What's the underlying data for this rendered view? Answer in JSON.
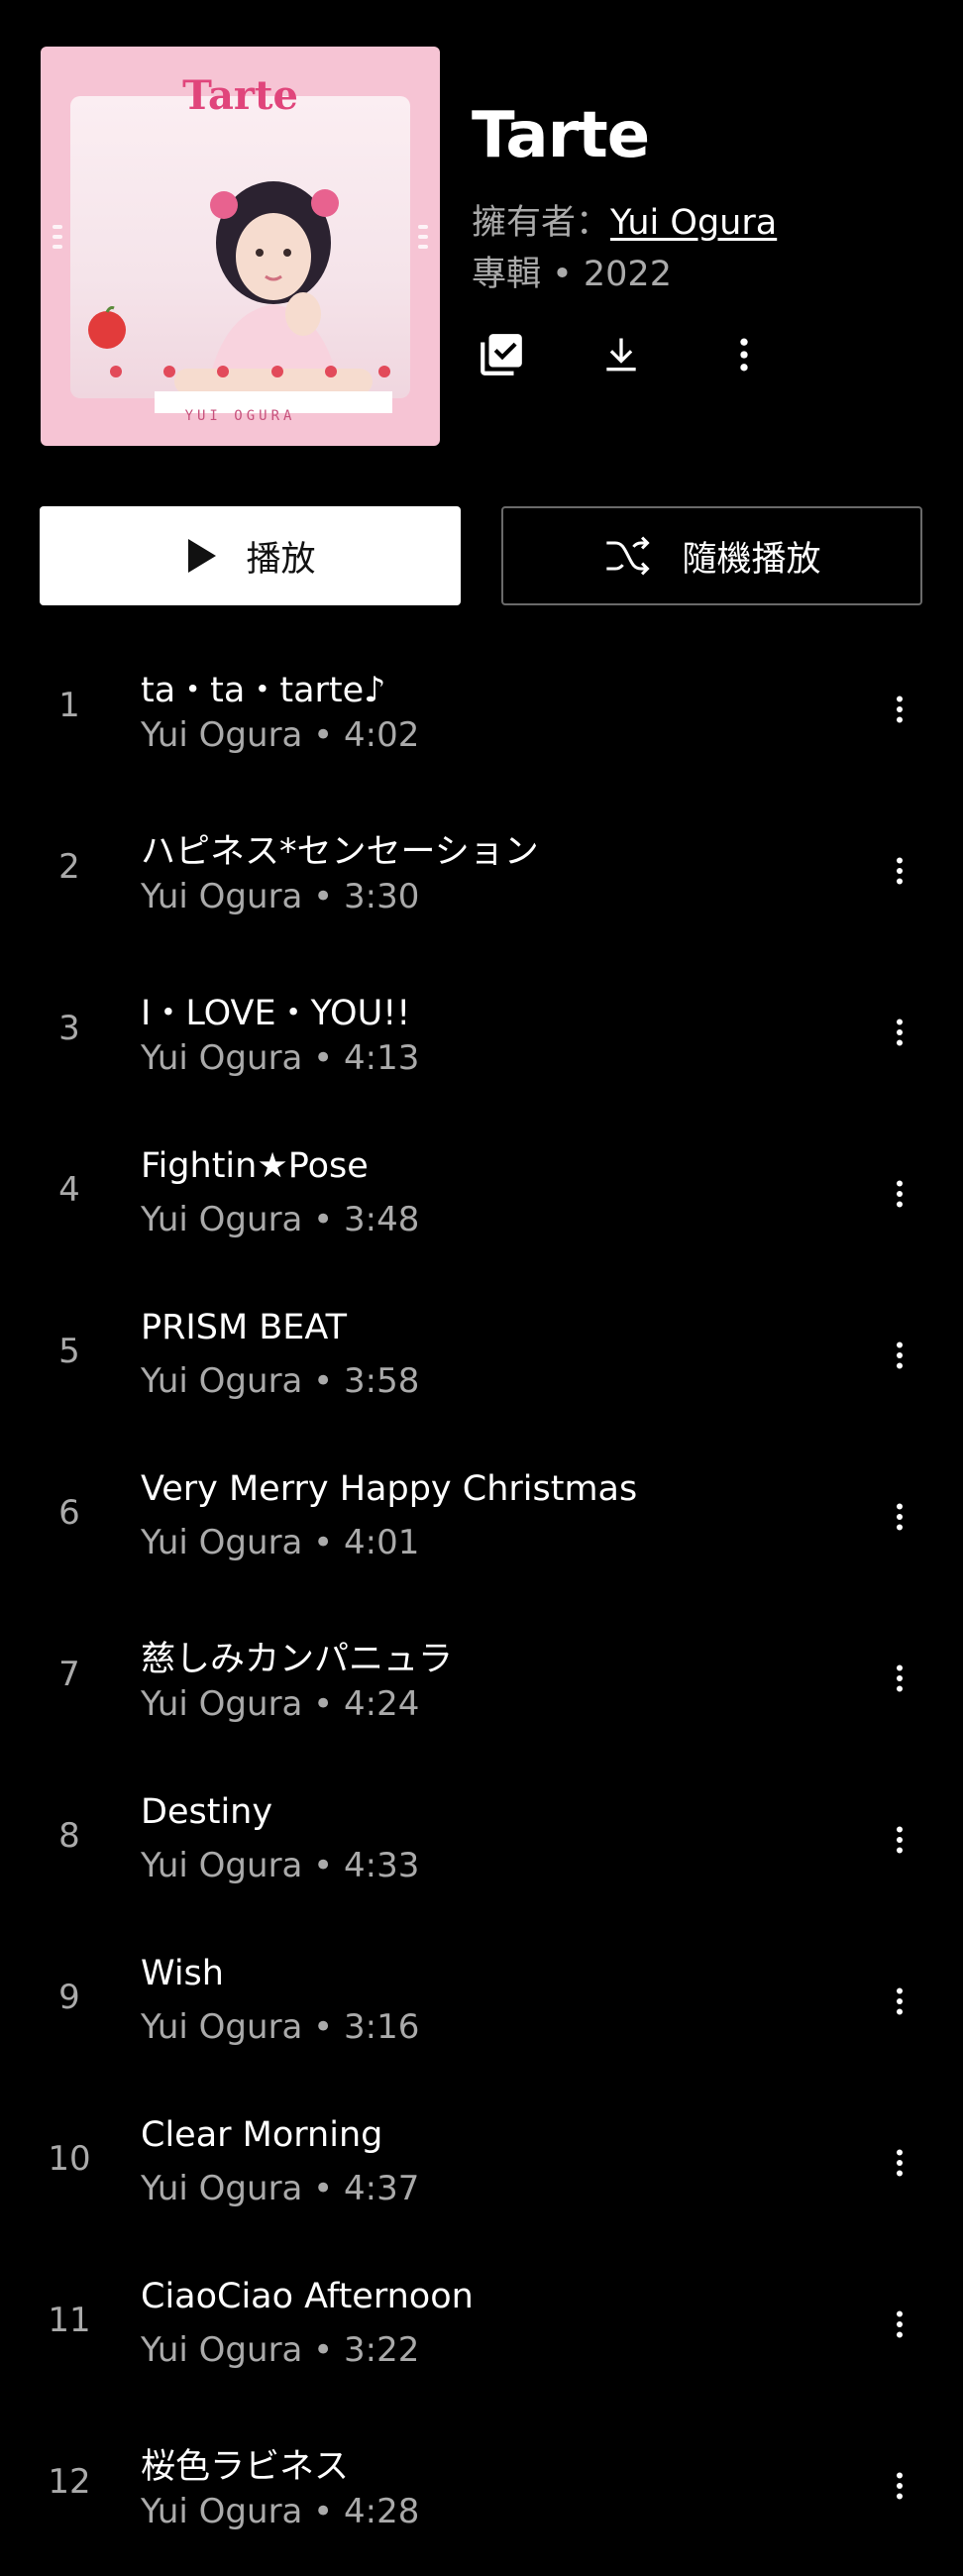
{
  "album": {
    "title": "Tarte",
    "owner_prefix": "擁有者：",
    "owner_name": "Yui Ogura",
    "meta": "專輯 • 2022",
    "cover": {
      "title": "Tarte",
      "artist": "YUI OGURA"
    }
  },
  "actions": {
    "library_icon": "library-add-check-icon",
    "download_icon": "download-icon",
    "more_icon": "more-vert-icon"
  },
  "buttons": {
    "play_label": "播放",
    "shuffle_label": "隨機播放"
  },
  "tracks": [
    {
      "num": "1",
      "title": "ta・ta・tarte♪",
      "subtitle": "Yui Ogura • 4:02"
    },
    {
      "num": "2",
      "title": "ハピネス*センセーション",
      "subtitle": "Yui Ogura • 3:30"
    },
    {
      "num": "3",
      "title": "I・LOVE・YOU!!",
      "subtitle": "Yui Ogura • 4:13"
    },
    {
      "num": "4",
      "title": "Fightin★Pose",
      "subtitle": "Yui Ogura • 3:48"
    },
    {
      "num": "5",
      "title": "PRISM BEAT",
      "subtitle": "Yui Ogura • 3:58"
    },
    {
      "num": "6",
      "title": "Very Merry Happy Christmas",
      "subtitle": "Yui Ogura • 4:01"
    },
    {
      "num": "7",
      "title": "慈しみカンパニュラ",
      "subtitle": "Yui Ogura • 4:24"
    },
    {
      "num": "8",
      "title": "Destiny",
      "subtitle": "Yui Ogura • 4:33"
    },
    {
      "num": "9",
      "title": "Wish",
      "subtitle": "Yui Ogura • 3:16"
    },
    {
      "num": "10",
      "title": "Clear Morning",
      "subtitle": "Yui Ogura • 4:37"
    },
    {
      "num": "11",
      "title": "CiaoCiao Afternoon",
      "subtitle": "Yui Ogura • 3:22"
    },
    {
      "num": "12",
      "title": "桜色ラビネス",
      "subtitle": "Yui Ogura • 4:28"
    }
  ],
  "colors": {
    "background": "#000000",
    "text_primary": "#ffffff",
    "text_secondary": "#aaaaaa",
    "cover_pink": "#f6c4d4",
    "cover_title": "#e0457b"
  }
}
